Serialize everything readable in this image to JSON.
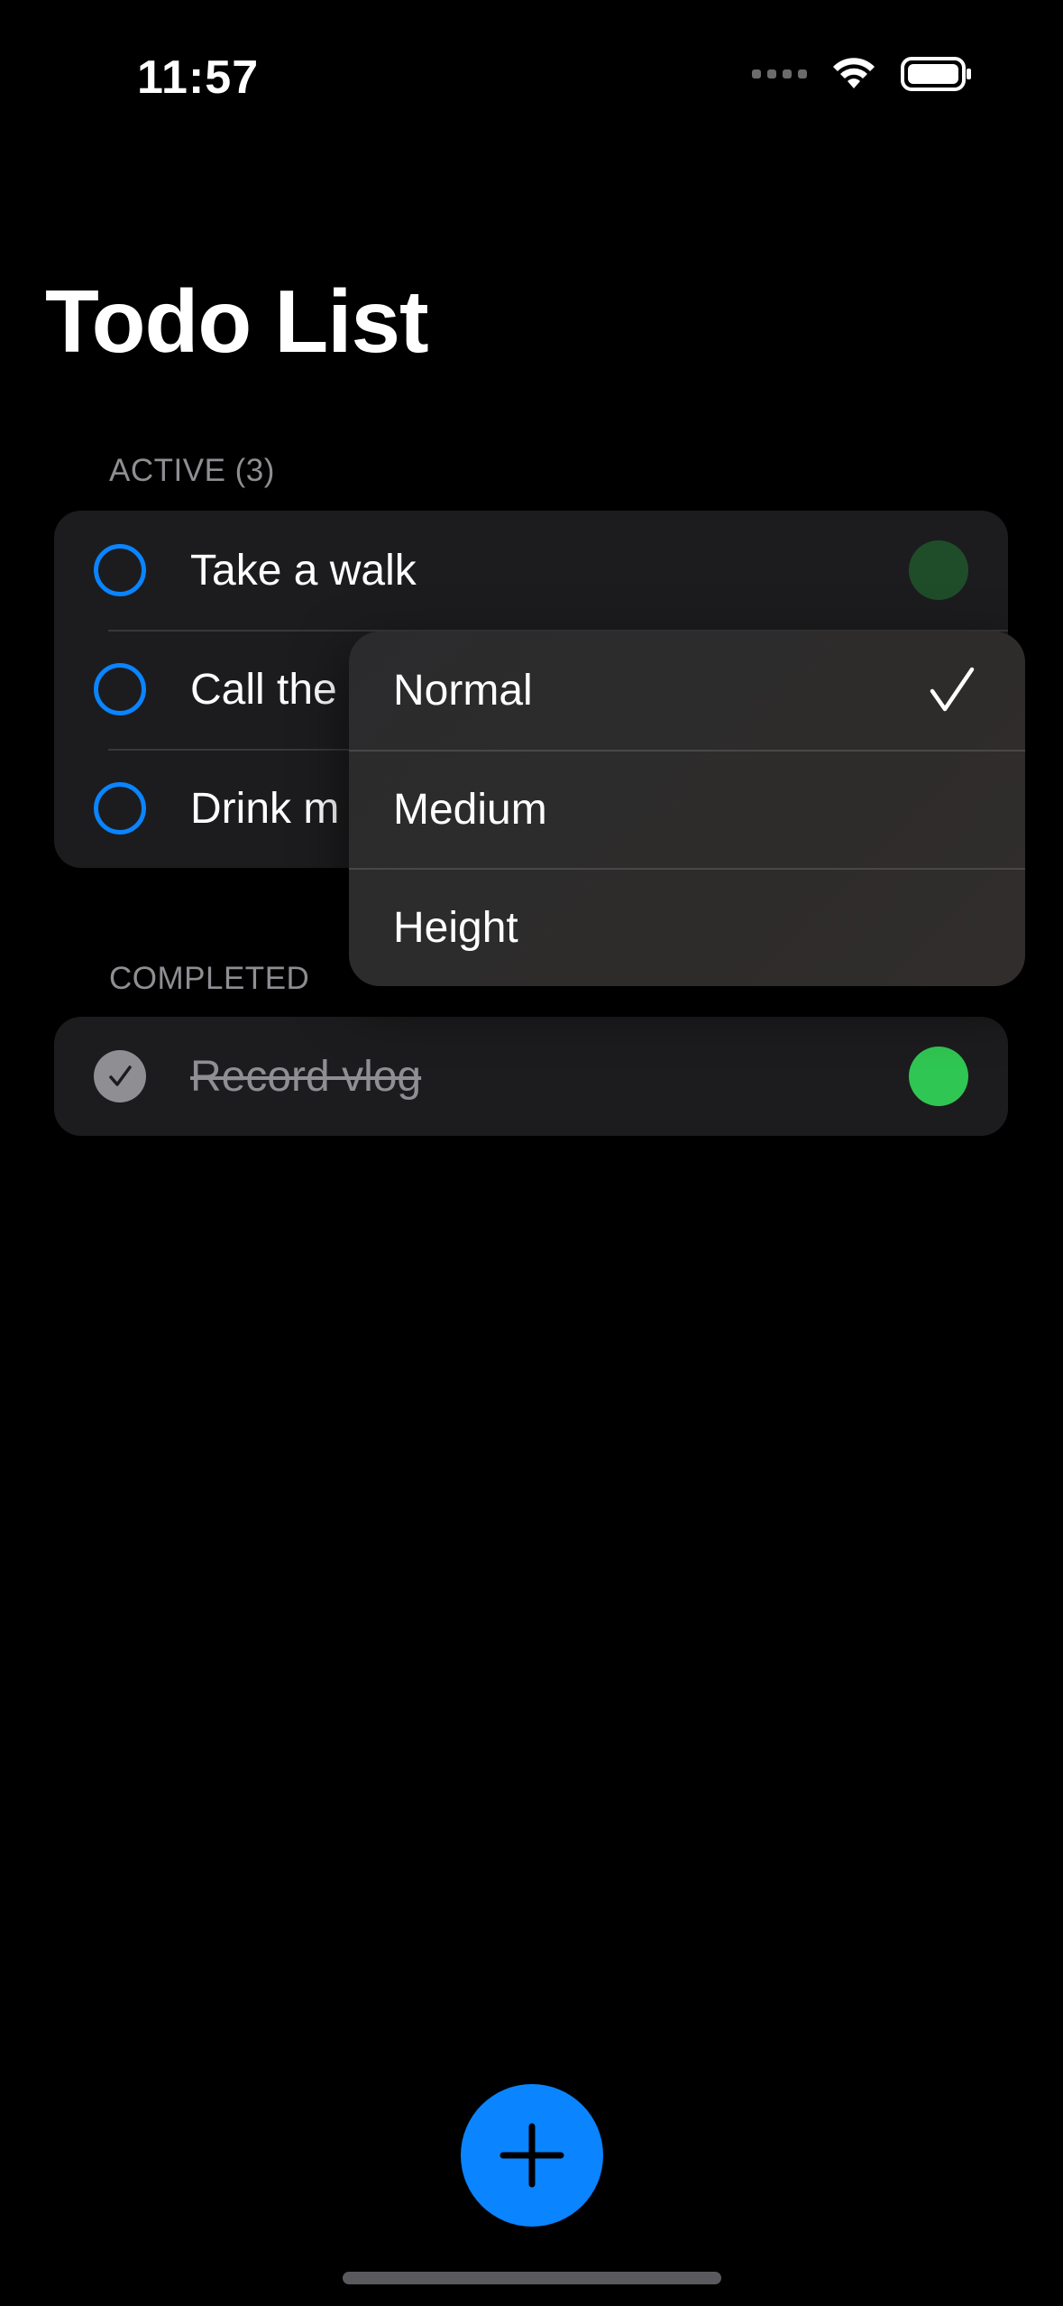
{
  "status_bar": {
    "time": "11:57"
  },
  "title": "Todo List",
  "sections": {
    "active": {
      "header": "ACTIVE (3)",
      "items": [
        {
          "label": "Take a walk",
          "priority_color": "#1f4d2a"
        },
        {
          "label": "Call the",
          "priority_color": ""
        },
        {
          "label": "Drink m",
          "priority_color": ""
        }
      ]
    },
    "completed": {
      "header": "COMPLETED",
      "items": [
        {
          "label": "Record vlog",
          "priority_color": "#30c653"
        }
      ]
    }
  },
  "priority_menu": {
    "options": [
      {
        "label": "Normal",
        "selected": true
      },
      {
        "label": "Medium",
        "selected": false
      },
      {
        "label": "Height",
        "selected": false
      }
    ]
  },
  "colors": {
    "accent": "#0a84ff",
    "background": "#000000",
    "card": "#1c1c1e",
    "secondary_text": "#8e8e93"
  },
  "icons": {
    "fab": "plus-icon",
    "menu_selected": "checkmark-icon",
    "completed_toggle": "checkmark-icon"
  }
}
